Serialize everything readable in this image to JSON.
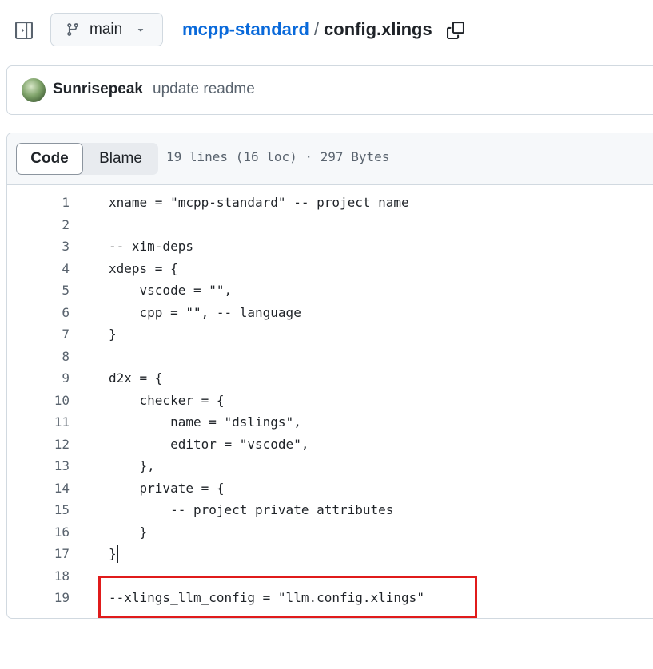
{
  "topbar": {
    "branch": "main",
    "repo": "mcpp-standard",
    "separator": "/",
    "file": "config.xlings"
  },
  "commit": {
    "author": "Sunrisepeak",
    "message": "update readme"
  },
  "file_header": {
    "tabs": [
      {
        "label": "Code",
        "active": true
      },
      {
        "label": "Blame",
        "active": false
      }
    ],
    "meta": "19 lines (16 loc) · 297 Bytes"
  },
  "code": {
    "lines": [
      {
        "n": "1",
        "text": "xname = \"mcpp-standard\" -- project name"
      },
      {
        "n": "2",
        "text": ""
      },
      {
        "n": "3",
        "text": "-- xim-deps"
      },
      {
        "n": "4",
        "text": "xdeps = {"
      },
      {
        "n": "5",
        "text": "    vscode = \"\","
      },
      {
        "n": "6",
        "text": "    cpp = \"\", -- language"
      },
      {
        "n": "7",
        "text": "}"
      },
      {
        "n": "8",
        "text": ""
      },
      {
        "n": "9",
        "text": "d2x = {"
      },
      {
        "n": "10",
        "text": "    checker = {"
      },
      {
        "n": "11",
        "text": "        name = \"dslings\","
      },
      {
        "n": "12",
        "text": "        editor = \"vscode\","
      },
      {
        "n": "13",
        "text": "    },"
      },
      {
        "n": "14",
        "text": "    private = {"
      },
      {
        "n": "15",
        "text": "        -- project private attributes"
      },
      {
        "n": "16",
        "text": "    }"
      },
      {
        "n": "17",
        "text": "}"
      },
      {
        "n": "18",
        "text": ""
      },
      {
        "n": "19",
        "text": "--xlings_llm_config = \"llm.config.xlings\""
      }
    ],
    "highlighted_line": "19"
  },
  "icons": {
    "sidebar_toggle": "sidebar-expand-icon",
    "branch": "git-branch-icon",
    "caret": "triangle-down-icon",
    "copy": "copy-icon"
  },
  "colors": {
    "link": "#0969da",
    "highlight_border": "#e01b1b",
    "border": "#d1d9e0"
  }
}
